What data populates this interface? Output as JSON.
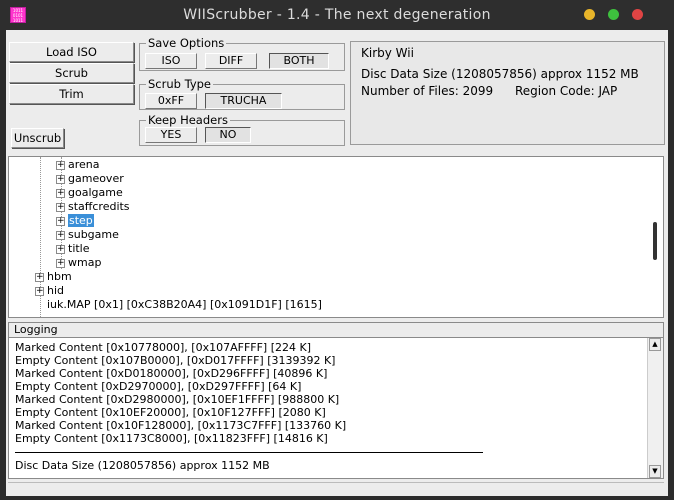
{
  "window": {
    "title": "WIIScrubber - 1.4 - The next degeneration",
    "icon_text": "1011 0101 1011"
  },
  "buttons": {
    "load_iso": "Load ISO",
    "scrub": "Scrub",
    "trim": "Trim",
    "unscrub": "Unscrub"
  },
  "save_options": {
    "label": "Save Options",
    "iso": "ISO",
    "diff": "DIFF",
    "both": "BOTH",
    "selected": "BOTH"
  },
  "scrub_type": {
    "label": "Scrub Type",
    "oxff": "0xFF",
    "trucha": "TRUCHA",
    "selected": "TRUCHA"
  },
  "keep_headers": {
    "label": "Keep Headers",
    "yes": "YES",
    "no": "NO",
    "selected": "NO"
  },
  "disc_info": {
    "game_title": "Kirby Wii",
    "data_size": "Disc Data Size (1208057856) approx  1152 MB",
    "num_files": "Number of Files: 2099",
    "region": "Region Code: JAP"
  },
  "tree": {
    "items": [
      {
        "label": "arena"
      },
      {
        "label": "gameover"
      },
      {
        "label": "goalgame"
      },
      {
        "label": "staffcredits"
      },
      {
        "label": "step"
      },
      {
        "label": "subgame"
      },
      {
        "label": "title"
      },
      {
        "label": "wmap"
      },
      {
        "label": "hbm"
      },
      {
        "label": "hid"
      },
      {
        "label": "iuk.MAP [0x1] [0xC38B20A4] [0x1091D1F] [1615]"
      }
    ],
    "selected": "step"
  },
  "logging": {
    "header": "Logging",
    "lines": [
      "Marked Content [0x10778000], [0x107AFFFF] [224 K]",
      "Empty Content [0x107B0000], [0xD017FFFF] [3139392 K]",
      "Marked Content [0xD0180000], [0xD296FFFF] [40896 K]",
      "Empty Content [0xD2970000], [0xD297FFFF] [64 K]",
      "Marked Content [0xD2980000], [0x10EF1FFFF] [988800 K]",
      "Empty Content [0x10EF20000], [0x10F127FFF] [2080 K]",
      "Marked Content [0x10F128000], [0x1173C7FFF] [133760 K]",
      "Empty Content [0x1173C8000], [0x11823FFF] [14816 K]"
    ],
    "summary": "Disc Data Size (1208057856) approx  1152 MB"
  },
  "icons": {
    "scroll_up": "up-arrow",
    "scroll_down": "down-arrow",
    "expand": "plus-box"
  },
  "colors": {
    "selection": "#3a8fd8",
    "window_bg": "#ececec",
    "titlebar": "#2e2e2e"
  }
}
